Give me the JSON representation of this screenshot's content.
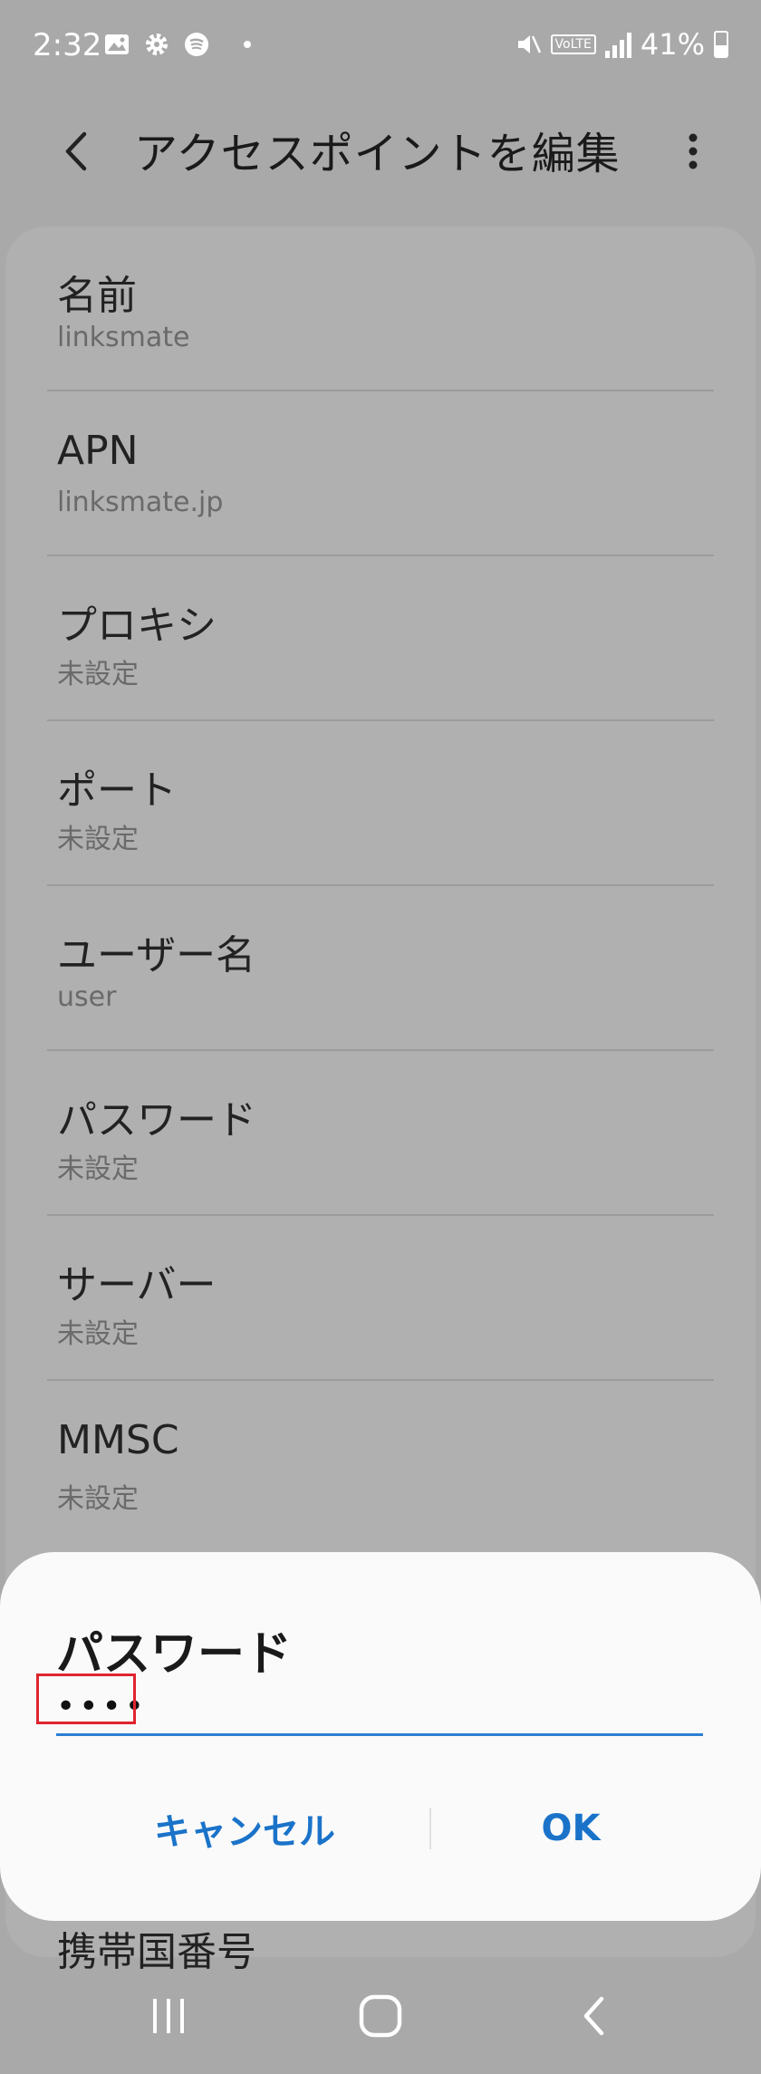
{
  "status_bar": {
    "time": "2:32",
    "icons": [
      "gallery-icon",
      "settings-icon",
      "spotify-icon",
      "notification-dot-icon",
      "mute-icon",
      "volte-icon",
      "signal-icon",
      "battery-icon"
    ],
    "volte_label": "VoLTE",
    "battery": "41%"
  },
  "header": {
    "title": "アクセスポイントを編集"
  },
  "list": {
    "items": [
      {
        "title": "名前",
        "value": "linksmate"
      },
      {
        "title": "APN",
        "value": "linksmate.jp"
      },
      {
        "title": "プロキシ",
        "value": "未設定"
      },
      {
        "title": "ポート",
        "value": "未設定"
      },
      {
        "title": "ユーザー名",
        "value": "user"
      },
      {
        "title": "パスワード",
        "value": "未設定"
      },
      {
        "title": "サーバー",
        "value": "未設定"
      },
      {
        "title": "MMSC",
        "value": "未設定"
      }
    ],
    "partial_item": "携帯国番号"
  },
  "dialog": {
    "title": "パスワード",
    "input_value": "••••",
    "cancel_label": "キャンセル",
    "ok_label": "OK"
  },
  "colors": {
    "accent": "#1a73c9",
    "input_underline": "#2a7fd3",
    "highlight": "#e0242f",
    "dim_background": "#a9a9a9"
  }
}
